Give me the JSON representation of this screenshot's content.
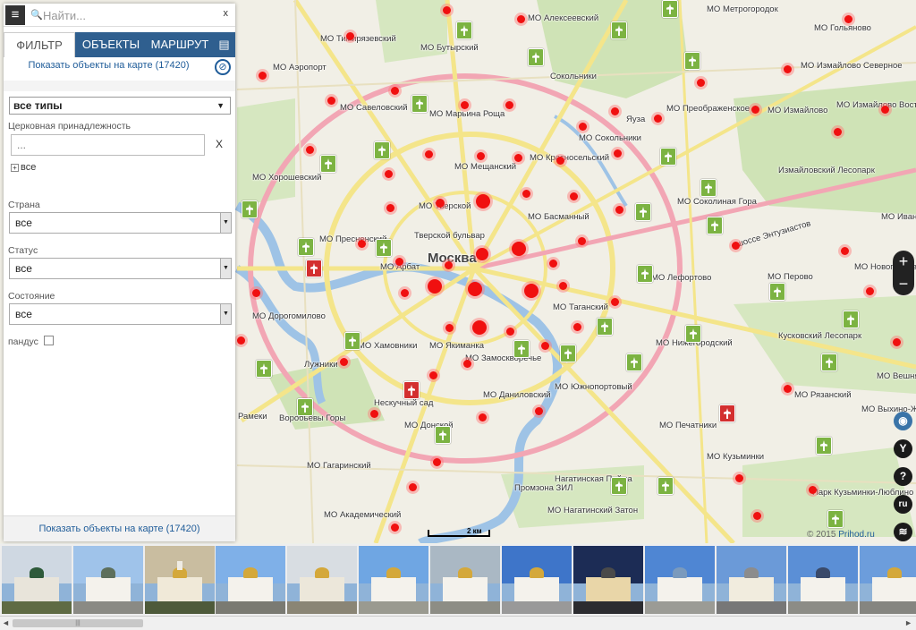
{
  "search": {
    "placeholder": "Найти...",
    "close": "x"
  },
  "tabs": {
    "filter": "ФИЛЬТР",
    "objects": "ОБЪЕКТЫ",
    "route": "МАРШРУТ"
  },
  "show_link_top": "Показать объекты на карте (17420)",
  "filter": {
    "type_value": "все типы",
    "church_label": "Церковная принадлежность",
    "church_placeholder": "...",
    "church_clear": "X",
    "church_tree_all": "все",
    "country_label": "Страна",
    "country_value": "все",
    "status_label": "Статус",
    "status_value": "все",
    "state_label": "Состояние",
    "state_value": "все",
    "pandus_label": "пандус"
  },
  "show_link_bottom": "Показать объекты на карте (17420)",
  "map": {
    "center_label": "Москва",
    "scale": "2 км",
    "copyright": "© 2015",
    "copyright_link": "Prihod.ru",
    "lang": "ru",
    "labels": [
      {
        "t": "МО Тимирязевский"
      },
      {
        "t": "МО Бутырский"
      },
      {
        "t": "МО Алексеевский"
      },
      {
        "t": "МО Метрогородок"
      },
      {
        "t": "МО Гольяново"
      },
      {
        "t": "МО Аэропорт"
      },
      {
        "t": "МО Измайлово Северное"
      },
      {
        "t": "МО Савеловский"
      },
      {
        "t": "МО Марьина Роща"
      },
      {
        "t": "МО Преображенское"
      },
      {
        "t": "МО Измайлово"
      },
      {
        "t": "МО Измайлово Восточное"
      },
      {
        "t": "МО Сокольники"
      },
      {
        "t": "МО Мещанский"
      },
      {
        "t": "МО Красносельский"
      },
      {
        "t": "МО Хорошевский"
      },
      {
        "t": "МО Тверской"
      },
      {
        "t": "МО Басманный"
      },
      {
        "t": "МО Соколиная Гора"
      },
      {
        "t": "МО Пресненский"
      },
      {
        "t": "МО Ивановское"
      },
      {
        "t": "МО Арбат"
      },
      {
        "t": "МО Перово"
      },
      {
        "t": "МО Новогиреево"
      },
      {
        "t": "МО Лефортово"
      },
      {
        "t": "МО Таганский"
      },
      {
        "t": "МО Дорогомилово"
      },
      {
        "t": "МО Хамовники"
      },
      {
        "t": "МО Якиманка"
      },
      {
        "t": "МО Замоскворечье"
      },
      {
        "t": "МО Нижегородский"
      },
      {
        "t": "МО Вешняки"
      },
      {
        "t": "МО Даниловский"
      },
      {
        "t": "МО Южнопортовый"
      },
      {
        "t": "МО Рязанский"
      },
      {
        "t": "МО Выхино-Жулебино"
      },
      {
        "t": "МО Донской"
      },
      {
        "t": "МО Печатники"
      },
      {
        "t": "МО Гагаринский"
      },
      {
        "t": "МО Кузьминки"
      },
      {
        "t": "МО Академический"
      },
      {
        "t": "МО Нагатинский Затон"
      },
      {
        "t": "шоссе Энтузиастов"
      },
      {
        "t": "Парк Кузьминки-Люблино"
      },
      {
        "t": "Измайловский Лесопарк"
      },
      {
        "t": "Кусковский Лесопарк"
      },
      {
        "t": "Нескучный сад"
      },
      {
        "t": "Воробьевы Горы"
      },
      {
        "t": "Рамеки"
      },
      {
        "t": "Тверской бульвар"
      },
      {
        "t": "Промзона ЗИЛ"
      },
      {
        "t": "Нагатинская Пойма"
      },
      {
        "t": "Москва"
      },
      {
        "t": "Лужники"
      },
      {
        "t": "Сокольники"
      },
      {
        "t": "Яуза"
      }
    ]
  },
  "icons": {
    "menu": "menu-icon",
    "search": "search-icon",
    "book": "book-icon",
    "no_map": "no-map-icon",
    "camera": "camera-icon",
    "route": "route-icon",
    "help": "help-icon",
    "layers": "layers-icon"
  },
  "colors": {
    "accent": "#2f5f8f",
    "marker": "#f01010",
    "church_green": "#7cb342",
    "link": "#1f5c99"
  },
  "strip": {
    "scroll_grip": "|||"
  }
}
